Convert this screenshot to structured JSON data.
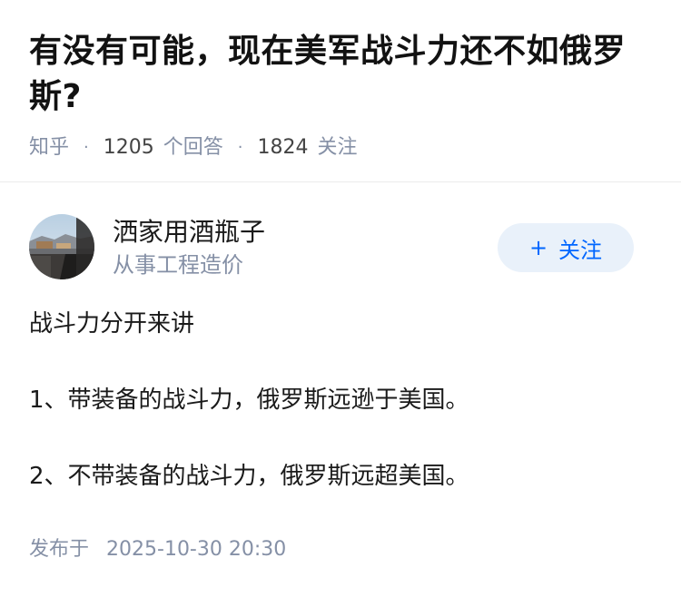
{
  "question": {
    "title": "有没有可能，现在美军战斗力还不如俄罗斯?",
    "source": "知乎",
    "answer_count": "1205",
    "answer_label": "个回答",
    "follow_count": "1824",
    "follow_label": "关注"
  },
  "answer": {
    "author": {
      "name": "洒家用酒瓶子",
      "bio": "从事工程造价",
      "avatar_icon": "avatar-photo"
    },
    "follow_button": {
      "icon": "+",
      "label": "关注"
    },
    "paragraphs": [
      "战斗力分开来讲",
      "1、带装备的战斗力，俄罗斯远逊于美国。",
      "2、不带装备的战斗力，俄罗斯远超美国。"
    ],
    "publish_label": "发布于",
    "publish_time": "2025-10-30 20:30"
  },
  "colors": {
    "accent": "#0066ff",
    "follow_bg": "#e9f1fa",
    "meta": "#8590a6",
    "text": "#1a1a1a"
  }
}
